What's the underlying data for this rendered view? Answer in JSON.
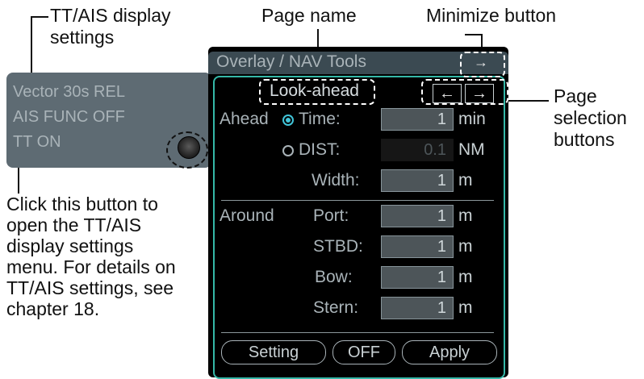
{
  "callouts": {
    "ttais_settings_line1": "TT/AIS display",
    "ttais_settings_line2": "settings",
    "page_name": "Page name",
    "minimize_button": "Minimize button",
    "page_selection_line1": "Page",
    "page_selection_line2": "selection",
    "page_selection_line3": "buttons",
    "click_note": [
      "Click this button to",
      "open the TT/AIS",
      "display settings",
      "menu. For details on",
      "TT/AIS settings, see",
      "chapter 18."
    ]
  },
  "ttais_box": {
    "lines": [
      "Vector 30s REL",
      "AIS FUNC OFF",
      "TT ON"
    ]
  },
  "panel": {
    "title": "Overlay / NAV Tools",
    "minimize_icon": "→",
    "page_name": "Look-ahead",
    "prev_icon": "←",
    "next_icon": "→",
    "ahead": {
      "label": "Ahead",
      "time_label": "Time:",
      "time_value": "1",
      "time_unit": "min",
      "dist_label": "DIST:",
      "dist_value": "0.1",
      "dist_unit": "NM",
      "width_label": "Width:",
      "width_value": "1",
      "width_unit": "m",
      "selected": "time"
    },
    "around": {
      "label": "Around",
      "port_label": "Port:",
      "port_value": "1",
      "stbd_label": "STBD:",
      "stbd_value": "1",
      "bow_label": "Bow:",
      "bow_value": "1",
      "stern_label": "Stern:",
      "stern_value": "1",
      "unit": "m"
    },
    "buttons": {
      "setting": "Setting",
      "off": "OFF",
      "apply": "Apply"
    }
  },
  "colors": {
    "panel_bg": "#000000",
    "frame_accent": "#35b8a8",
    "radio_selected": "#41c4d8",
    "ttais_box": "#5e6b73"
  }
}
